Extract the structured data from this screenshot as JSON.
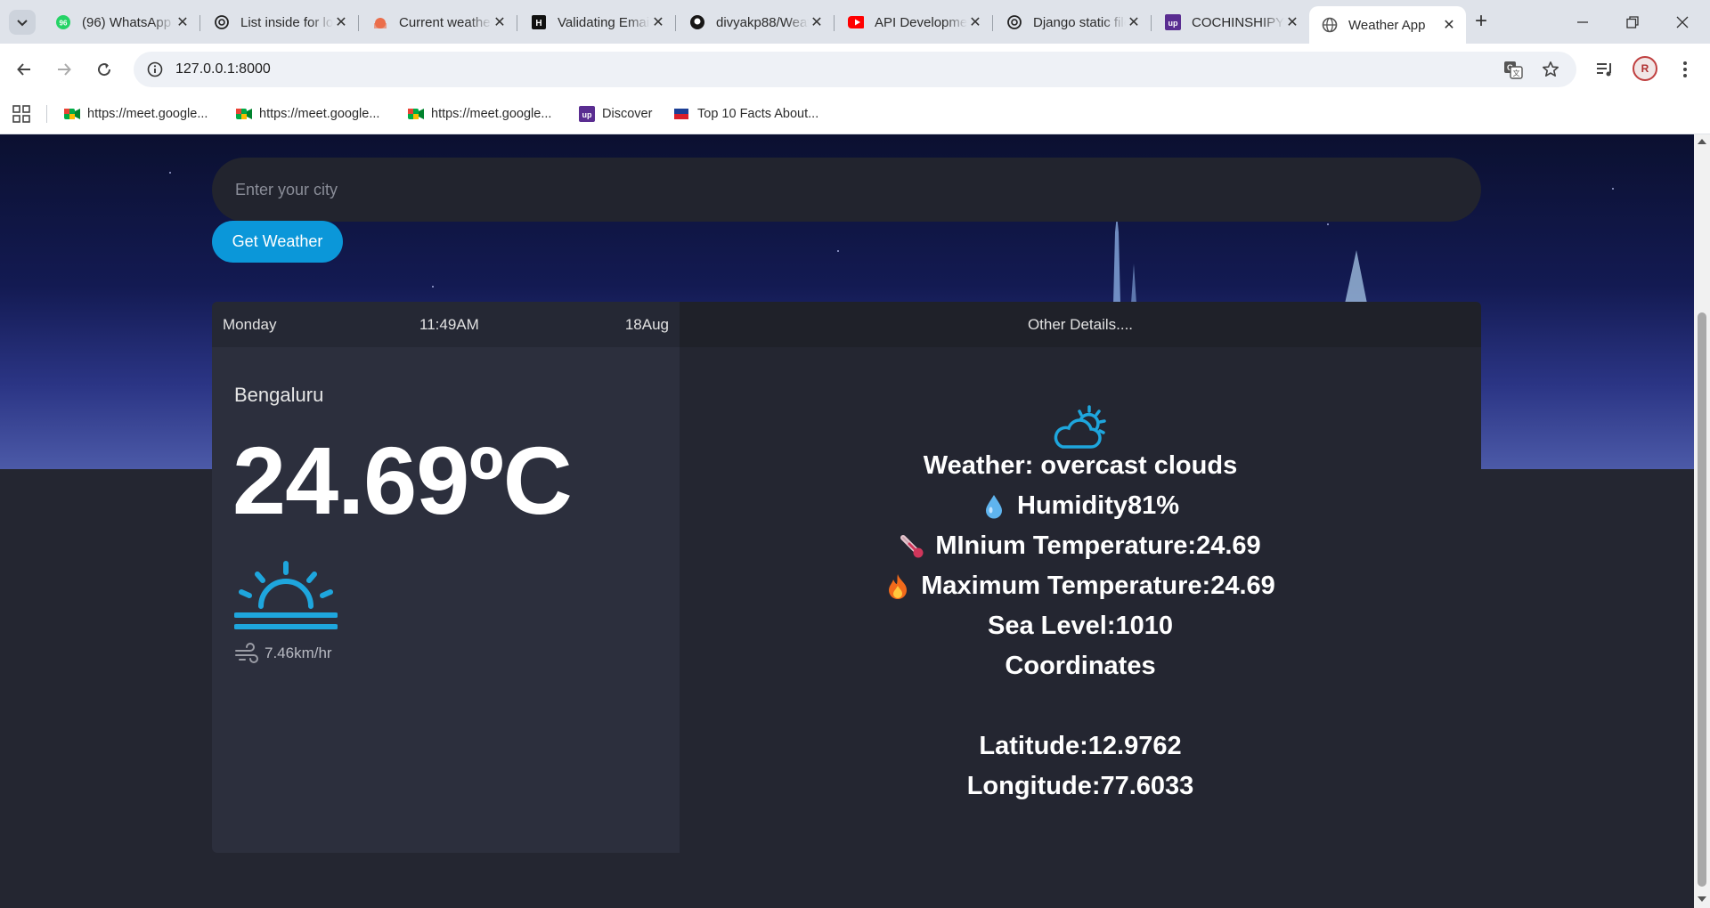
{
  "browser": {
    "tabs": [
      {
        "title": "(96) WhatsApp",
        "favicon": "whatsapp-icon",
        "active": false
      },
      {
        "title": "List inside for loop",
        "favicon": "openai-icon",
        "active": false
      },
      {
        "title": "Current weather data",
        "favicon": "openweather-icon",
        "active": false
      },
      {
        "title": "Validating Email",
        "favicon": "hashnode-icon",
        "active": false
      },
      {
        "title": "divyakp88/Weather",
        "favicon": "github-icon",
        "active": false
      },
      {
        "title": "API Development",
        "favicon": "youtube-icon",
        "active": false
      },
      {
        "title": "Django static files",
        "favicon": "openai-icon",
        "active": false
      },
      {
        "title": "COCHINSHIPYARD",
        "favicon": "upstox-icon",
        "active": false
      },
      {
        "title": "Weather App",
        "favicon": "globe-icon",
        "active": true
      }
    ],
    "address": "127.0.0.1:8000",
    "bookmarks": [
      {
        "label": "https://meet.google...",
        "icon": "google-meet-icon"
      },
      {
        "label": "https://meet.google...",
        "icon": "google-meet-icon"
      },
      {
        "label": "https://meet.google...",
        "icon": "google-meet-icon"
      },
      {
        "label": "Discover",
        "icon": "upstox-icon"
      },
      {
        "label": "Top 10 Facts About...",
        "icon": "flag-icon"
      }
    ],
    "avatar_initials": "R"
  },
  "search": {
    "placeholder": "Enter your city",
    "value": "",
    "button_label": "Get Weather"
  },
  "current": {
    "day": "Monday",
    "time": "11:49AM",
    "date": "18Aug",
    "city": "Bengaluru",
    "temperature": "24.69ºC",
    "condition_icon": "sunrise-icon",
    "wind": "7.46km/hr"
  },
  "details": {
    "heading": "Other Details....",
    "icon": "partly-cloudy-icon",
    "weather": "Weather: overcast clouds",
    "humidity": "Humidity81%",
    "min_temp": "MInium Temperature:24.69",
    "max_temp": "Maximum Temperature:24.69",
    "sea_level": "Sea Level:1010",
    "coordinates_label": "Coordinates",
    "latitude": "Latitude:12.9762",
    "longitude": "Longitude:77.6033"
  },
  "colors": {
    "accent": "#0b97d9",
    "icon_blue": "#1ea6dd",
    "card_left": "#2c2f3d",
    "card_right": "#242631",
    "hero_top": "#0b1030",
    "hero_bottom": "#4c5aa8"
  }
}
